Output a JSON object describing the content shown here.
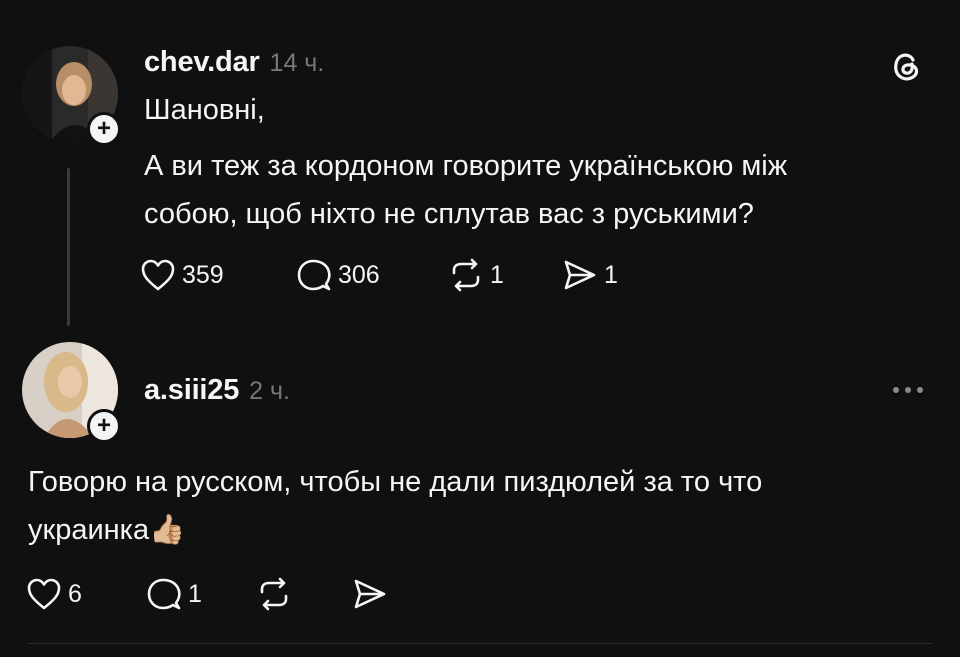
{
  "post": {
    "username": "chev.dar",
    "time": "14 ч.",
    "greeting": "Шановні,",
    "body": "А ви теж за кордоном говорите українською між\nсобою, щоб ніхто не сплутав вас з руськими?",
    "likes": "359",
    "comments": "306",
    "reposts": "1",
    "shares": "1",
    "app_icon": "threads-logo-icon"
  },
  "reply": {
    "username": "a.siii25",
    "time": "2 ч.",
    "body": "Говорю на русском, чтобы не дали пиздюлей за то что\nукраинка",
    "emoji": "👍🏼",
    "likes": "6",
    "comments": "1",
    "more_icon": "more-dots-icon"
  },
  "colors": {
    "background": "#101010",
    "text": "#f3f5f7",
    "muted": "#777777"
  }
}
